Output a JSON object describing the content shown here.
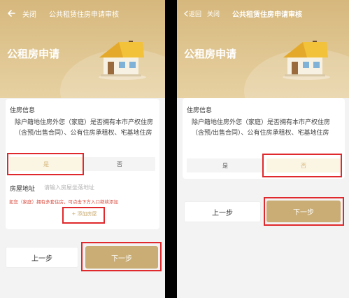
{
  "left": {
    "topbar": {
      "back_icon": "arrow-left-icon",
      "close_label": "关闭",
      "title": "公共租赁住房申请审核"
    },
    "hero_title": "公租房申请",
    "section_title": "住房信息",
    "question": "除户籍地住房外您（家庭）是否拥有本市产权住房（含预/出售合同）、公有住房承租权、宅基地住房",
    "options": {
      "yes": "是",
      "no": "否",
      "selected": "yes"
    },
    "address": {
      "label": "房屋地址",
      "placeholder": "请输入房屋坐落地址"
    },
    "hint": "如您（家庭）拥有多套住房，可点击下方入口继续添加",
    "add_house_label": "+ 添加房屋",
    "buttons": {
      "prev": "上一步",
      "next": "下一步"
    }
  },
  "right": {
    "topbar": {
      "back_label": "返回",
      "close_label": "关闭",
      "title": "公共租赁住房申请审核"
    },
    "hero_title": "公租房申请",
    "section_title": "住房信息",
    "question": "除户籍地住房外您（家庭）是否拥有本市产权住房（含预/出售合同）、公有住房承租权、宅基地住房",
    "options": {
      "yes": "是",
      "no": "否",
      "selected": "no"
    },
    "buttons": {
      "prev": "上一步",
      "next": "下一步"
    }
  },
  "colors": {
    "accent": "#c9ad74",
    "hero": "#d6b87d",
    "highlight": "#e0292c",
    "hint": "#d94a3c"
  }
}
